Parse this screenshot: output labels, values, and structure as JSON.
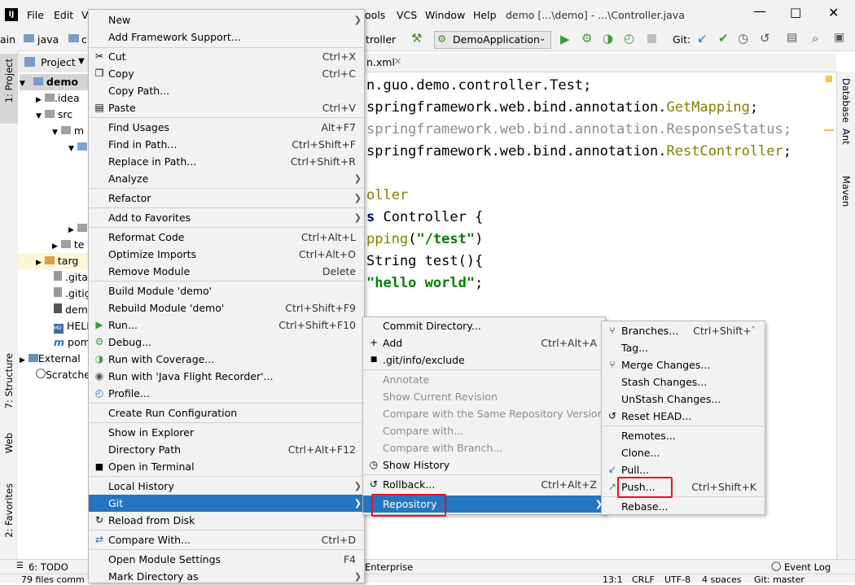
{
  "window": {
    "title": "demo [...\\demo] - ...\\Controller.java",
    "app_logo": "IJ",
    "menubar": [
      "File",
      "Edit",
      "V",
      "ools",
      "VCS",
      "Window",
      "Help"
    ]
  },
  "toolbar": {
    "breadcrumb_1": "ain",
    "breadcrumb_2": "java",
    "breadcrumb_3": "c",
    "breadcrumb_tail": "troller",
    "run_config": "DemoApplication",
    "git_label": "Git:"
  },
  "left_strip": {
    "project": "1: Project",
    "structure": "7: Structure",
    "web": "Web",
    "favorites": "2: Favorites"
  },
  "right_strip": {
    "database": "Database",
    "ant": "Ant",
    "maven": "Maven"
  },
  "project_panel": {
    "header": "Project",
    "rows": [
      "demo",
      ".idea",
      "src",
      "m",
      "",
      "",
      "",
      "",
      "te",
      "targ",
      ".gita",
      ".gitig",
      "dem",
      "HELP",
      "pom",
      "External",
      "Scratche"
    ]
  },
  "editor": {
    "tab": "n.xml",
    "lines": [
      {
        "pre": "n.guo.demo.controller.Test;",
        "ann": ""
      },
      {
        "pre": "springframework.web.bind.annotation.",
        "ann": "GetMapping",
        "post": ";"
      },
      {
        "pre": "springframework.web.bind.annotation.ResponseStatus;",
        "gray": true
      },
      {
        "pre": "springframework.web.bind.annotation.",
        "ann": "RestController",
        "post": ";"
      },
      {
        "pre": "",
        "ann": ""
      },
      {
        "ann": "oller"
      },
      {
        "kw": "s ",
        "pre": "Controller {"
      },
      {
        "ann": "pping",
        "pre": "(",
        "str": "\"/test\"",
        "post": ")"
      },
      {
        "pre": "String test(){"
      },
      {
        "str": "\"hello world\"",
        "post": ";"
      }
    ]
  },
  "context_menu": {
    "items": [
      {
        "label": "New",
        "arrow": true
      },
      {
        "label": "Add Framework Support..."
      },
      {
        "label": "Cut",
        "shortcut": "Ctrl+X",
        "icon": "scissors-icon"
      },
      {
        "label": "Copy",
        "shortcut": "Ctrl+C",
        "icon": "copy-icon"
      },
      {
        "label": "Copy Path..."
      },
      {
        "label": "Paste",
        "shortcut": "Ctrl+V",
        "icon": "paste-icon"
      },
      {
        "label": "Find Usages",
        "shortcut": "Alt+F7"
      },
      {
        "label": "Find in Path...",
        "shortcut": "Ctrl+Shift+F"
      },
      {
        "label": "Replace in Path...",
        "shortcut": "Ctrl+Shift+R"
      },
      {
        "label": "Analyze",
        "arrow": true
      },
      {
        "label": "Refactor",
        "arrow": true
      },
      {
        "label": "Add to Favorites",
        "arrow": true
      },
      {
        "label": "Reformat Code",
        "shortcut": "Ctrl+Alt+L"
      },
      {
        "label": "Optimize Imports",
        "shortcut": "Ctrl+Alt+O"
      },
      {
        "label": "Remove Module",
        "shortcut": "Delete"
      },
      {
        "label": "Build Module 'demo'"
      },
      {
        "label": "Rebuild Module 'demo'",
        "shortcut": "Ctrl+Shift+F9"
      },
      {
        "label": "Run...",
        "shortcut": "Ctrl+Shift+F10",
        "icon": "run-icon"
      },
      {
        "label": "Debug...",
        "icon": "debug-icon"
      },
      {
        "label": "Run with Coverage...",
        "icon": "coverage-icon"
      },
      {
        "label": "Run with 'Java Flight Recorder'...",
        "icon": "flight-recorder-icon"
      },
      {
        "label": "Profile...",
        "icon": "profile-icon"
      },
      {
        "label": "Create Run Configuration"
      },
      {
        "label": "Show in Explorer"
      },
      {
        "label": "Directory Path",
        "shortcut": "Ctrl+Alt+F12"
      },
      {
        "label": "Open in Terminal",
        "icon": "terminal-icon"
      },
      {
        "label": "Local History",
        "arrow": true
      },
      {
        "label": "Git",
        "arrow": true,
        "selected": true
      },
      {
        "label": "Reload from Disk",
        "icon": "reload-icon"
      },
      {
        "label": "Compare With...",
        "shortcut": "Ctrl+D",
        "icon": "compare-icon"
      },
      {
        "label": "Open Module Settings",
        "shortcut": "F4"
      },
      {
        "label": "Mark Directory as",
        "arrow": true
      }
    ]
  },
  "git_menu": {
    "items": [
      {
        "label": "Commit Directory..."
      },
      {
        "label": "Add",
        "shortcut": "Ctrl+Alt+A",
        "icon": "plus-icon"
      },
      {
        "label": ".git/info/exclude",
        "icon": "gitignore-icon"
      },
      {
        "label": "Annotate",
        "disabled": true
      },
      {
        "label": "Show Current Revision",
        "disabled": true
      },
      {
        "label": "Compare with the Same Repository Version",
        "disabled": true
      },
      {
        "label": "Compare with...",
        "disabled": true
      },
      {
        "label": "Compare with Branch...",
        "disabled": true
      },
      {
        "label": "Show History",
        "icon": "history-icon"
      },
      {
        "label": "Rollback...",
        "shortcut": "Ctrl+Alt+Z",
        "icon": "rollback-icon"
      },
      {
        "label": "Repository",
        "arrow": true,
        "selected": true
      }
    ]
  },
  "repo_menu": {
    "items": [
      {
        "label": "Branches...",
        "shortcut": "Ctrl+Shift+`",
        "icon": "branch-icon"
      },
      {
        "label": "Tag..."
      },
      {
        "label": "Merge Changes...",
        "icon": "merge-icon"
      },
      {
        "label": "Stash Changes..."
      },
      {
        "label": "UnStash Changes..."
      },
      {
        "label": "Reset HEAD...",
        "icon": "reset-icon"
      },
      {
        "label": "Remotes..."
      },
      {
        "label": "Clone..."
      },
      {
        "label": "Pull...",
        "icon": "pull-icon"
      },
      {
        "label": "Push...",
        "shortcut": "Ctrl+Shift+K",
        "icon": "push-icon"
      },
      {
        "label": "Rebase..."
      }
    ]
  },
  "bottom_bar": {
    "todo": "6: TODO",
    "enterprise": "Enterprise",
    "event_log": "Event Log"
  },
  "status_bar": {
    "left": "79 files comm",
    "position": "13:1",
    "line_sep": "CRLF",
    "encoding": "UTF-8",
    "indent": "4 spaces",
    "branch": "Git: master"
  },
  "colors": {
    "selection": "#2675bf",
    "highlight_box": "#e81123",
    "annotation": "#808000",
    "string": "#008000"
  }
}
